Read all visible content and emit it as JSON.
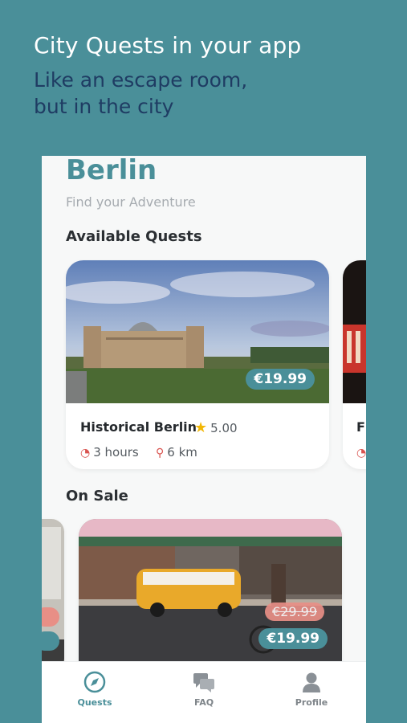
{
  "promo": {
    "headline": "City Quests in your app",
    "subline_1": "Like an escape room,",
    "subline_2": "but in the city"
  },
  "header": {
    "city": "Berlin",
    "subtitle": "Find your Adventure"
  },
  "sections": {
    "available": "Available Quests",
    "on_sale": "On Sale"
  },
  "available_quests": [
    {
      "name": "Historical Berlin",
      "rating": "5.00",
      "duration": "3 hours",
      "distance": "6 km",
      "price": "€19.99"
    },
    {
      "name_peek": "F"
    }
  ],
  "sale_quests": [
    {
      "old_price": "€29.99",
      "price": "€19.99"
    }
  ],
  "nav": {
    "quests": "Quests",
    "faq": "FAQ",
    "profile": "Profile"
  },
  "colors": {
    "brand": "#4a8f99",
    "title_navy": "#1f3c63",
    "accent_red": "#d9534f",
    "star": "#f2b705"
  },
  "icons": {
    "star": "star-icon",
    "time": "clock-icon",
    "distance": "location-pin-icon",
    "quests_nav": "compass-icon",
    "faq_nav": "chat-bubbles-icon",
    "profile_nav": "user-icon"
  }
}
